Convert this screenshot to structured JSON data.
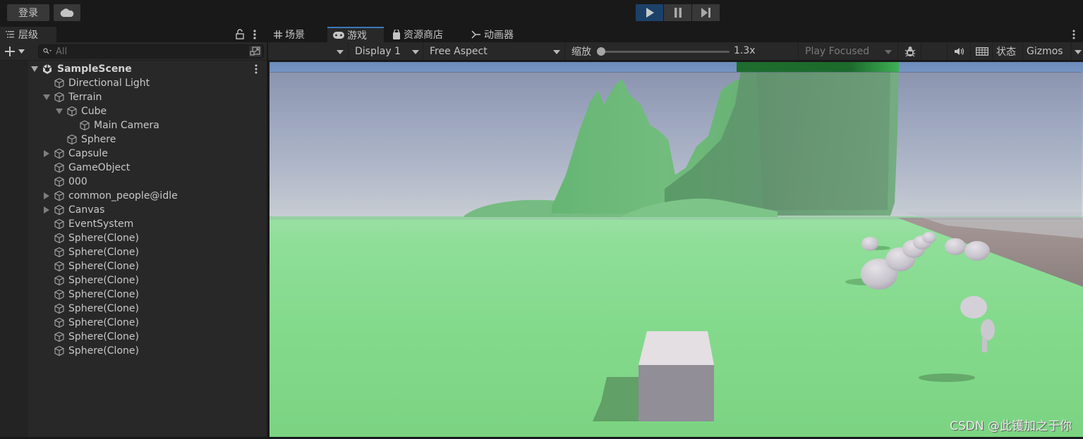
{
  "toolbar": {
    "login_label": "登录",
    "cloud_icon": "cloud-icon",
    "play_controls": [
      {
        "name": "play-button",
        "icon": "play-icon",
        "active": true
      },
      {
        "name": "pause-button",
        "icon": "pause-icon",
        "active": false
      },
      {
        "name": "step-button",
        "icon": "step-icon",
        "active": false
      }
    ],
    "accent_color": "#1b4169"
  },
  "hierarchy": {
    "tab_label": "层级",
    "search_placeholder": "All",
    "scene": "SampleScene",
    "items": [
      {
        "label": "Directional Light",
        "depth": 1,
        "expander": "none"
      },
      {
        "label": "Terrain",
        "depth": 1,
        "expander": "expanded"
      },
      {
        "label": "Cube",
        "depth": 2,
        "expander": "expanded"
      },
      {
        "label": "Main Camera",
        "depth": 3,
        "expander": "none"
      },
      {
        "label": "Sphere",
        "depth": 2,
        "expander": "none"
      },
      {
        "label": "Capsule",
        "depth": 1,
        "expander": "collapsed"
      },
      {
        "label": "GameObject",
        "depth": 1,
        "expander": "none"
      },
      {
        "label": "000",
        "depth": 1,
        "expander": "none"
      },
      {
        "label": "common_people@idle",
        "depth": 1,
        "expander": "collapsed"
      },
      {
        "label": "Canvas",
        "depth": 1,
        "expander": "collapsed"
      },
      {
        "label": "EventSystem",
        "depth": 1,
        "expander": "none"
      },
      {
        "label": "Sphere(Clone)",
        "depth": 1,
        "expander": "none"
      },
      {
        "label": "Sphere(Clone)",
        "depth": 1,
        "expander": "none"
      },
      {
        "label": "Sphere(Clone)",
        "depth": 1,
        "expander": "none"
      },
      {
        "label": "Sphere(Clone)",
        "depth": 1,
        "expander": "none"
      },
      {
        "label": "Sphere(Clone)",
        "depth": 1,
        "expander": "none"
      },
      {
        "label": "Sphere(Clone)",
        "depth": 1,
        "expander": "none"
      },
      {
        "label": "Sphere(Clone)",
        "depth": 1,
        "expander": "none"
      },
      {
        "label": "Sphere(Clone)",
        "depth": 1,
        "expander": "none"
      },
      {
        "label": "Sphere(Clone)",
        "depth": 1,
        "expander": "none"
      }
    ]
  },
  "game": {
    "tabs": [
      {
        "label": "场景",
        "icon": "grid-icon",
        "active": false
      },
      {
        "label": "游戏",
        "icon": "gamepad-icon",
        "active": true
      },
      {
        "label": "资源商店",
        "icon": "shopping-bag-icon",
        "active": false
      },
      {
        "label": "动画器",
        "icon": "animator-icon",
        "active": false
      }
    ],
    "toolbar": {
      "display": "Display 1",
      "aspect": "Free Aspect",
      "scale_label": "缩放",
      "scale_value": "1.3x",
      "scale_fraction": 0.0,
      "play_mode": "Play Focused",
      "stats_label": "状态",
      "gizmos_label": "Gizmos"
    },
    "watermark": "CSDN @此镬加之于你"
  }
}
